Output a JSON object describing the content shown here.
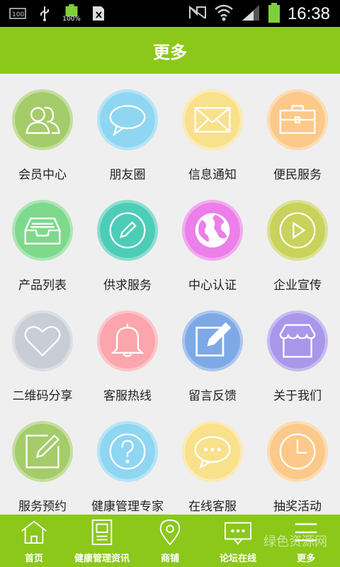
{
  "status_bar": {
    "time": "16:38",
    "battery_percent": "100%"
  },
  "header": {
    "title": "更多"
  },
  "grid": [
    {
      "label": "会员中心",
      "icon": "members-icon",
      "color": "#a5cc6a"
    },
    {
      "label": "朋友圈",
      "icon": "chat-bubble-icon",
      "color": "#8fd6f2"
    },
    {
      "label": "信息通知",
      "icon": "envelope-icon",
      "color": "#f9e08b"
    },
    {
      "label": "便民服务",
      "icon": "briefcase-icon",
      "color": "#fcc98a"
    },
    {
      "label": "产品列表",
      "icon": "inbox-tray-icon",
      "color": "#7ed98d"
    },
    {
      "label": "供求服务",
      "icon": "pencil-circle-icon",
      "color": "#4dcdb8"
    },
    {
      "label": "中心认证",
      "icon": "globe-icon",
      "color": "#ec7fe9"
    },
    {
      "label": "企业宣传",
      "icon": "play-circle-icon",
      "color": "#c9d25a"
    },
    {
      "label": "二维码分享",
      "icon": "heart-icon",
      "color": "#c8cdd6"
    },
    {
      "label": "客服热线",
      "icon": "bell-icon",
      "color": "#fca5ac"
    },
    {
      "label": "留言反馈",
      "icon": "edit-note-icon",
      "color": "#7fa8e6"
    },
    {
      "label": "关于我们",
      "icon": "store-icon",
      "color": "#a897ea"
    },
    {
      "label": "服务预约",
      "icon": "edit-square-icon",
      "color": "#a5cc6a"
    },
    {
      "label": "健康管理专家",
      "icon": "question-circle-icon",
      "color": "#8fd6f2"
    },
    {
      "label": "在线客服",
      "icon": "speech-dots-icon",
      "color": "#f9e08b"
    },
    {
      "label": "抽奖活动",
      "icon": "clock-icon",
      "color": "#fcc98a"
    }
  ],
  "tabbar": [
    {
      "label": "首页",
      "icon": "home-icon"
    },
    {
      "label": "健康管理资讯",
      "icon": "document-icon"
    },
    {
      "label": "商铺",
      "icon": "map-pin-icon"
    },
    {
      "label": "论坛在线",
      "icon": "forum-icon"
    },
    {
      "label": "更多",
      "icon": "menu-icon"
    }
  ],
  "watermark": "绿色资源网"
}
